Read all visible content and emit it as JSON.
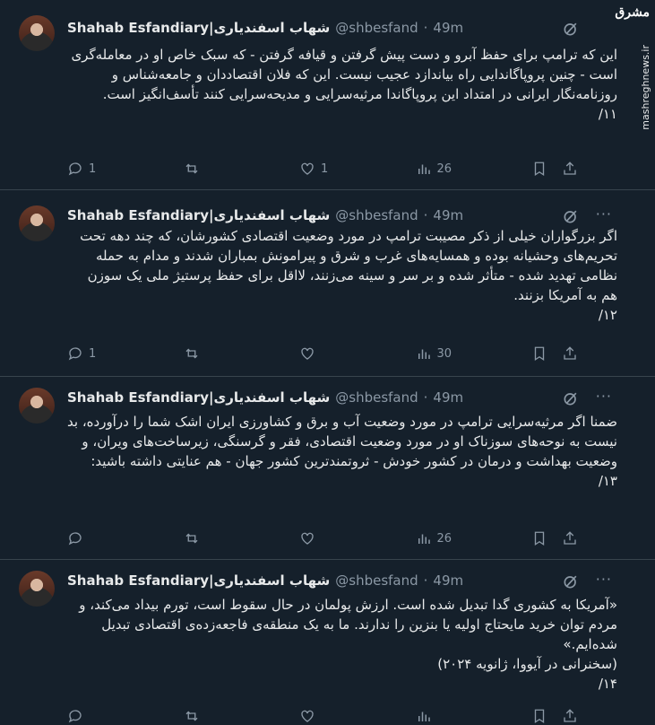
{
  "watermark": {
    "logo": "مشرق",
    "site": "mashreghnews.ir"
  },
  "author": {
    "name": "Shahab Esfandiary|شهاب اسفندیاری",
    "handle": "@shbesfand",
    "dot": "·"
  },
  "tweets": [
    {
      "time": "49m",
      "text": "این که ترامپ برای حفظ آبرو و دست پیش گرفتن و قیافه گرفتن - که سبک خاص او در معامله‌گری است - چنین پروپاگاندایی راه بیاندازد عجیب نیست. این که فلان اقتصاددان و جامعه‌شناس و روزنامه‌نگار ایرانی در امتداد این پروپاگاندا مرثیه‌سرایی و مدیحه‌سرایی کنند تأسف‌انگیز است.\n۱۱/",
      "replies": "1",
      "reposts": "",
      "likes": "1",
      "views": "26"
    },
    {
      "time": "49m",
      "text": "اگر بزرگواران خیلی از ذکر مصیبت ترامپ در مورد وضعیت اقتصادی کشورشان، که چند دهه تحت تحریم‌های وحشیانه بوده و همسایه‌های غرب و شرق و پیرامونش بمباران شدند و مدام به حمله نظامی تهدید شده - متأثر شده و بر سر و سینه می‌زنند، لااقل برای حفظ پرستیژ ملی یک سوزن هم به آمریکا بزنند.\n۱۲/",
      "replies": "1",
      "reposts": "",
      "likes": "",
      "views": "30"
    },
    {
      "time": "49m",
      "text": "ضمنا اگر مرثیه‌سرایی ترامپ در مورد وضعیت آب و برق و کشاورزی ایران اشک شما را درآورده، بد نیست به نوحه‌های سوزناک او در مورد وضعیت اقتصادی، فقر و گرسنگی، زیرساخت‌های ویران، و وضعیت بهداشت و درمان در کشور خودش - ثروتمندترین کشور جهان - هم عنایتی داشته باشید:\n۱۳/",
      "replies": "",
      "reposts": "",
      "likes": "",
      "views": "26"
    },
    {
      "time": "49m",
      "text": "«آمریکا به کشوری گدا تبدیل شده است. ارزش پولمان در حال سقوط است، تورم بیداد می‌کند، و مردم توان خرید مایحتاج اولیه یا بنزین را ندارند. ما به یک منطقه‌ی فاجعه‌زده‌ی اقتصادی تبدیل شده‌ایم.»\n(سخنرانی در آیووا، ژانویه ۲۰۲۴)\n۱۴/",
      "replies": "",
      "reposts": "",
      "likes": "",
      "views": ""
    }
  ]
}
